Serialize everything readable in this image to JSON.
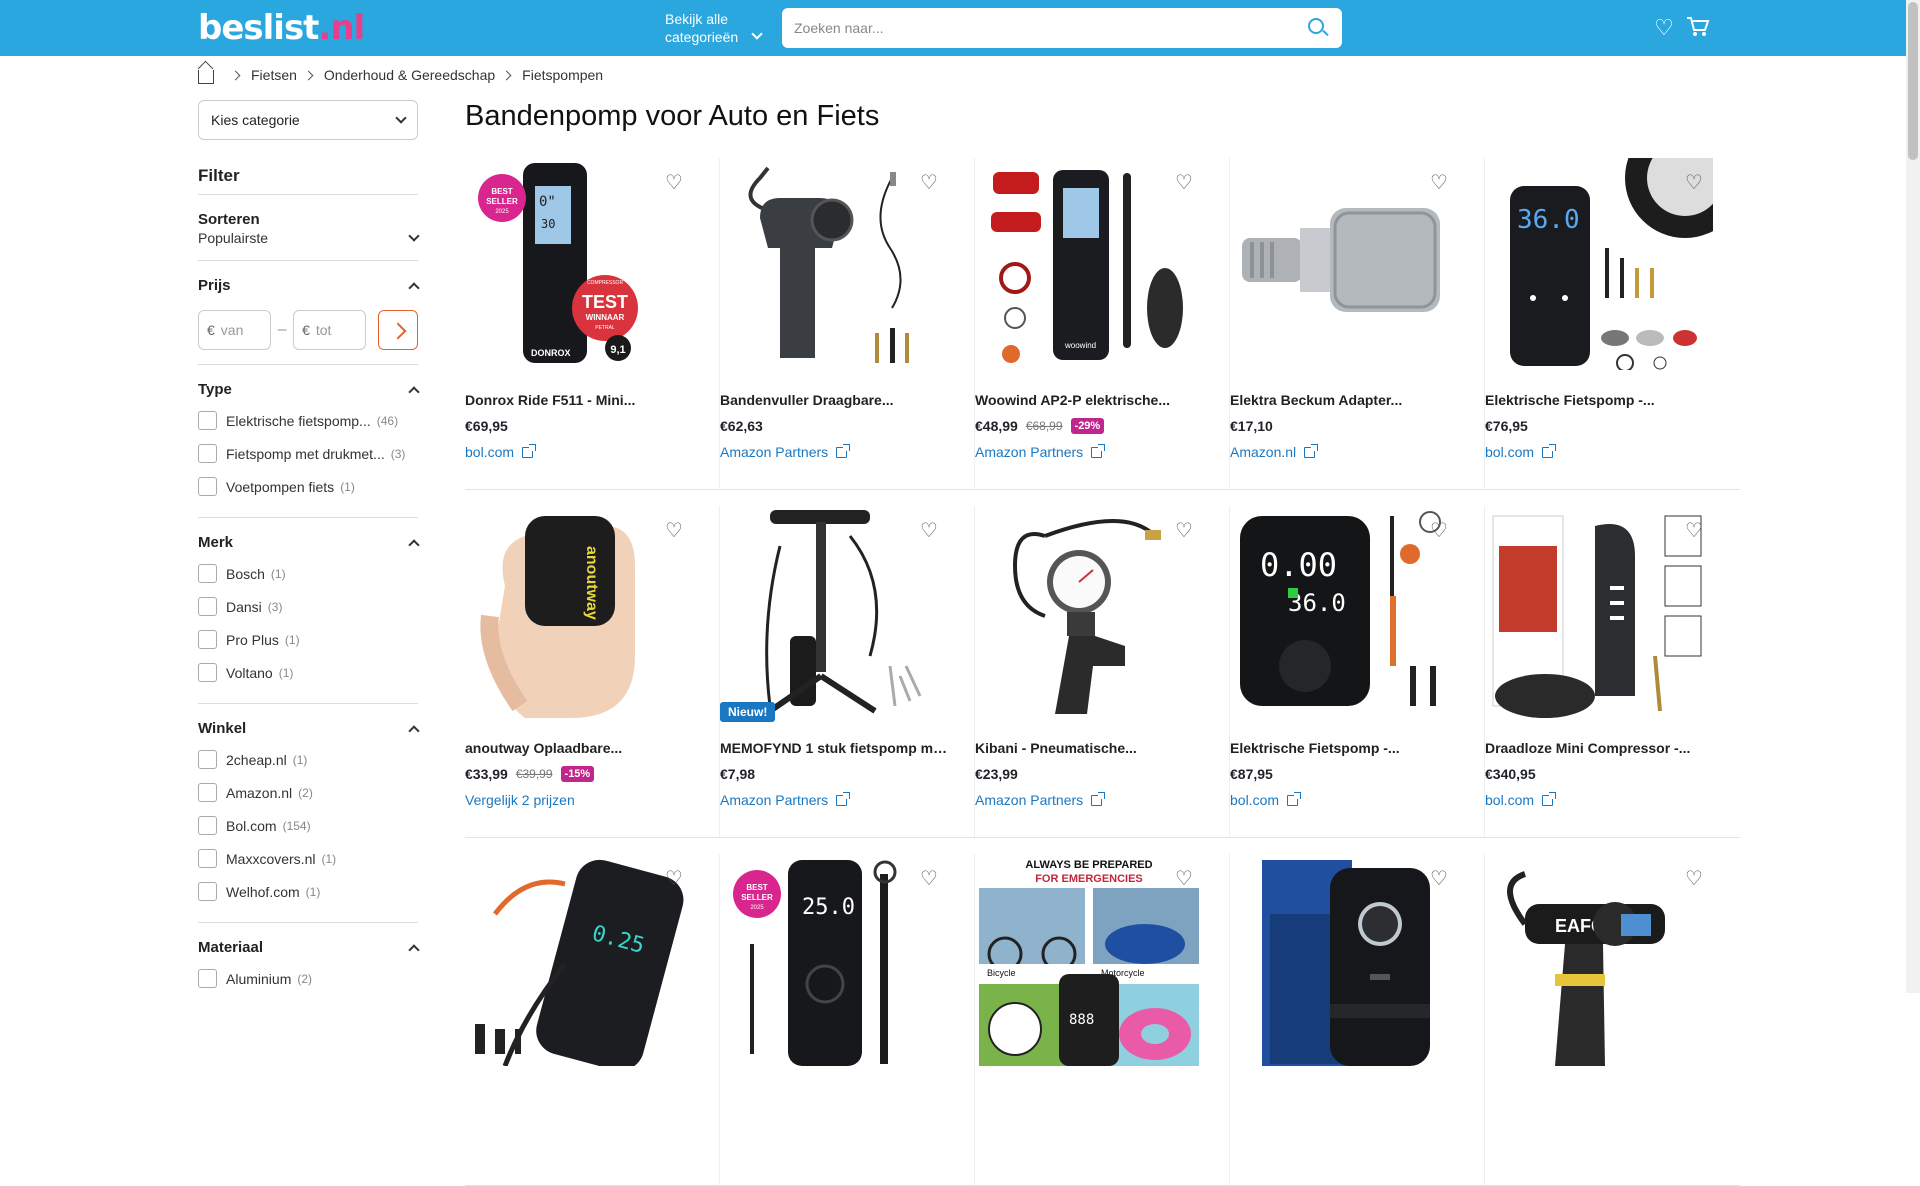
{
  "header": {
    "logo": "beslist",
    "logo_tld": ".nl",
    "categories_line1": "Bekijk alle",
    "categories_line2": "categorieën",
    "search_placeholder": "Zoeken naar..."
  },
  "breadcrumb": [
    "Fietsen",
    "Onderhoud & Gereedschap",
    "Fietspompen"
  ],
  "sidebar": {
    "category_select": "Kies categorie",
    "filter_title": "Filter",
    "sort": {
      "label": "Sorteren",
      "value": "Populairste"
    },
    "price": {
      "label": "Prijs",
      "currency": "€",
      "from_placeholder": "van",
      "to_placeholder": "tot"
    },
    "type": {
      "label": "Type",
      "options": [
        {
          "label": "Elektrische fietspomp...",
          "count": "(46)"
        },
        {
          "label": "Fietspomp met drukmet...",
          "count": "(3)"
        },
        {
          "label": "Voetpompen fiets",
          "count": "(1)"
        }
      ]
    },
    "brand": {
      "label": "Merk",
      "options": [
        {
          "label": "Bosch",
          "count": "(1)"
        },
        {
          "label": "Dansi",
          "count": "(3)"
        },
        {
          "label": "Pro Plus",
          "count": "(1)"
        },
        {
          "label": "Voltano",
          "count": "(1)"
        }
      ]
    },
    "shop": {
      "label": "Winkel",
      "options": [
        {
          "label": "2cheap.nl",
          "count": "(1)"
        },
        {
          "label": "Amazon.nl",
          "count": "(2)"
        },
        {
          "label": "Bol.com",
          "count": "(154)"
        },
        {
          "label": "Maxxcovers.nl",
          "count": "(1)"
        },
        {
          "label": "Welhof.com",
          "count": "(1)"
        }
      ]
    },
    "material": {
      "label": "Materiaal",
      "options": [
        {
          "label": "Aluminium",
          "count": "(2)"
        }
      ]
    }
  },
  "page_title": "Bandenpomp voor Auto en Fiets",
  "products": [
    {
      "name": "Donrox Ride F511 - Mini...",
      "price": "€69,95",
      "old_price": "",
      "discount": "",
      "shop": "bol.com",
      "badge": "",
      "icon": "black-compressor-best-seller"
    },
    {
      "name": "Bandenvuller Draagbare...",
      "price": "€62,63",
      "old_price": "",
      "discount": "",
      "shop": "Amazon Partners",
      "badge": "",
      "icon": "handheld-inflator"
    },
    {
      "name": "Woowind AP2-P elektrische...",
      "price": "€48,99",
      "old_price": "€68,99",
      "discount": "-29%",
      "shop": "Amazon Partners",
      "badge": "",
      "icon": "pump-with-accessories"
    },
    {
      "name": "Elektra Beckum Adapter...",
      "price": "€17,10",
      "old_price": "",
      "discount": "",
      "shop": "Amazon.nl",
      "badge": "",
      "icon": "metal-adapter"
    },
    {
      "name": "Elektrische Fietspomp -...",
      "price": "€76,95",
      "old_price": "",
      "discount": "",
      "shop": "bol.com",
      "badge": "",
      "icon": "digital-pump-tire"
    },
    {
      "name": "anoutway Oplaadbare...",
      "price": "€33,99",
      "old_price": "€39,99",
      "discount": "-15%",
      "shop": "Vergelijk 2 prijzen",
      "badge": "",
      "icon": "mini-pump-in-hand"
    },
    {
      "name": "MEMOFYND 1 stuk fietspomp me...",
      "price": "€7,98",
      "old_price": "",
      "discount": "",
      "shop": "Amazon Partners",
      "badge": "Nieuw!",
      "icon": "floor-pump"
    },
    {
      "name": "Kibani - Pneumatische...",
      "price": "€23,99",
      "old_price": "",
      "discount": "",
      "shop": "Amazon Partners",
      "badge": "",
      "icon": "tire-gauge-gun"
    },
    {
      "name": "Elektrische Fietspomp -...",
      "price": "€87,95",
      "old_price": "",
      "discount": "",
      "shop": "bol.com",
      "badge": "",
      "icon": "digital-display-pump"
    },
    {
      "name": "Draadloze Mini Compressor -...",
      "price": "€340,95",
      "old_price": "",
      "discount": "",
      "shop": "bol.com",
      "badge": "",
      "icon": "cordless-compressor"
    },
    {
      "name": "",
      "price": "",
      "old_price": "",
      "discount": "",
      "shop": "",
      "badge": "",
      "icon": "compressor-with-hose"
    },
    {
      "name": "",
      "price": "",
      "old_price": "",
      "discount": "",
      "shop": "",
      "badge": "",
      "icon": "best-seller-pump"
    },
    {
      "name": "",
      "price": "",
      "old_price": "",
      "discount": "",
      "shop": "",
      "badge": "",
      "icon": "emergency-pump-collage",
      "caption1": "ALWAYS BE PREPARED",
      "caption2": "FOR EMERGENCIES",
      "tile_labels": [
        "Bicycle",
        "Motorcycle"
      ]
    },
    {
      "name": "",
      "price": "",
      "old_price": "",
      "discount": "",
      "shop": "",
      "badge": "",
      "icon": "air-compressor-box"
    },
    {
      "name": "",
      "price": "",
      "old_price": "",
      "discount": "",
      "shop": "",
      "badge": "",
      "icon": "eafc-inflator-gun",
      "brand_text": "EAFC"
    }
  ],
  "image_labels": {
    "best_seller_1": "BEST",
    "best_seller_2": "SELLER",
    "best_seller_year": "2025",
    "test_top": "COMPRESSOR",
    "test_mid": "TEST",
    "test_bottom": "WINNAAR",
    "test_sub": "PETRAL",
    "score": "9,1",
    "donrox": "DONROX",
    "lcd_1": "0\"",
    "lcd_2": "30",
    "big_display": "36.0",
    "display_a": "0.00",
    "display_b": "36.0",
    "display_c": "25.0",
    "display_d": "0.25",
    "anoutway": "anoutway",
    "woowind": "woowind"
  },
  "colors": {
    "header": "#2aa7df",
    "accent": "#e8612c",
    "link": "#1a78c2",
    "discount": "#c0268b",
    "logo_tld": "#e83e8c"
  }
}
